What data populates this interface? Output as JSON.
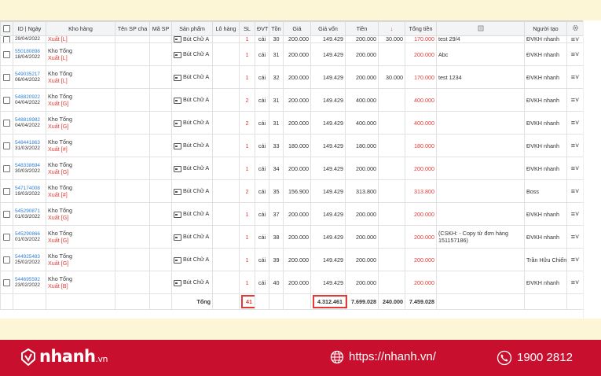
{
  "columns": [
    "",
    "ID | Ngày",
    "Kho hàng",
    "Tên SP cha",
    "Mã SP",
    "Sản phẩm",
    "Lô hàng",
    "SL",
    "ĐVT",
    "Tồn",
    "Giá",
    "Giá vốn",
    "Tiền",
    "↓",
    "Tổng tiền",
    "",
    "Người tạo",
    ""
  ],
  "partial_row": {
    "date": "29/04/2022",
    "warehouse_type": "Xuất [L]",
    "product": "Bút Chữ A",
    "qty": "1",
    "unit": "cái",
    "stock": "30",
    "price": "200.000",
    "cost": "149.429",
    "amount": "200.000",
    "discount": "30.000",
    "total": "170.000",
    "note": "test 29/4",
    "creator": "ĐVKH nhanh"
  },
  "rows": [
    {
      "id": "550180898",
      "date": "18/04/2022",
      "warehouse": "Kho Tổng",
      "warehouse_type": "Xuất [L]",
      "product": "Bút Chữ A",
      "qty": "1",
      "unit": "cái",
      "stock": "31",
      "price": "200.000",
      "cost": "149.429",
      "amount": "200.000",
      "discount": "",
      "total": "200.000",
      "note": "Abc",
      "creator": "ĐVKH nhanh"
    },
    {
      "id": "549035217",
      "date": "06/04/2022",
      "warehouse": "Kho Tổng",
      "warehouse_type": "Xuất [L]",
      "product": "Bút Chữ A",
      "qty": "1",
      "unit": "cái",
      "stock": "32",
      "price": "200.000",
      "cost": "149.429",
      "amount": "200.000",
      "discount": "30.000",
      "total": "170.000",
      "note": "test 1234",
      "creator": "ĐVKH nhanh"
    },
    {
      "id": "548820922",
      "date": "04/04/2022",
      "warehouse": "Kho Tổng",
      "warehouse_type": "Xuất [G]",
      "product": "Bút Chữ A",
      "qty": "2",
      "unit": "cái",
      "stock": "31",
      "price": "200.000",
      "cost": "149.429",
      "amount": "400.000",
      "discount": "",
      "total": "400.000",
      "note": "",
      "creator": "ĐVKH nhanh"
    },
    {
      "id": "548819982",
      "date": "04/04/2022",
      "warehouse": "Kho Tổng",
      "warehouse_type": "Xuất [G]",
      "product": "Bút Chữ A",
      "qty": "2",
      "unit": "cái",
      "stock": "31",
      "price": "200.000",
      "cost": "149.429",
      "amount": "400.000",
      "discount": "",
      "total": "400.000",
      "note": "",
      "creator": "ĐVKH nhanh"
    },
    {
      "id": "548441863",
      "date": "31/03/2022",
      "warehouse": "Kho Tổng",
      "warehouse_type": "Xuất [#]",
      "product": "Bút Chữ A",
      "qty": "1",
      "unit": "cái",
      "stock": "33",
      "price": "180.000",
      "cost": "149.429",
      "amount": "180.000",
      "discount": "",
      "total": "180.000",
      "note": "",
      "creator": "ĐVKH nhanh"
    },
    {
      "id": "548338694",
      "date": "30/03/2022",
      "warehouse": "Kho Tổng",
      "warehouse_type": "Xuất [G]",
      "product": "Bút Chữ A",
      "qty": "1",
      "unit": "cái",
      "stock": "34",
      "price": "200.000",
      "cost": "149.429",
      "amount": "200.000",
      "discount": "",
      "total": "200.000",
      "note": "",
      "creator": "ĐVKH nhanh"
    },
    {
      "id": "547174008",
      "date": "19/03/2022",
      "warehouse": "Kho Tổng",
      "warehouse_type": "Xuất [#]",
      "product": "Bút Chữ A",
      "qty": "2",
      "unit": "cái",
      "stock": "35",
      "price": "156.900",
      "cost": "149.429",
      "amount": "313.800",
      "discount": "",
      "total": "313.800",
      "note": "",
      "creator": "Boss"
    },
    {
      "id": "545290871",
      "date": "01/03/2022",
      "warehouse": "Kho Tổng",
      "warehouse_type": "Xuất [G]",
      "product": "Bút Chữ A",
      "qty": "1",
      "unit": "cái",
      "stock": "37",
      "price": "200.000",
      "cost": "149.429",
      "amount": "200.000",
      "discount": "",
      "total": "200.000",
      "note": "",
      "creator": "ĐVKH nhanh"
    },
    {
      "id": "545290866",
      "date": "01/03/2022",
      "warehouse": "Kho Tổng",
      "warehouse_type": "Xuất [G]",
      "product": "Bút Chữ A",
      "qty": "1",
      "unit": "cái",
      "stock": "38",
      "price": "200.000",
      "cost": "149.429",
      "amount": "200.000",
      "discount": "",
      "total": "200.000",
      "note": "(CSKH: - Copy từ đơn hàng 151157186)",
      "creator": "ĐVKH nhanh"
    },
    {
      "id": "544925483",
      "date": "25/02/2022",
      "warehouse": "Kho Tổng",
      "warehouse_type": "Xuất [G]",
      "product": "Bút Chữ A",
      "qty": "1",
      "unit": "cái",
      "stock": "39",
      "price": "200.000",
      "cost": "149.429",
      "amount": "200.000",
      "discount": "",
      "total": "200.000",
      "note": "",
      "creator": "Trần Hữu Chiến"
    },
    {
      "id": "544695592",
      "date": "23/02/2022",
      "warehouse": "Kho Tổng",
      "warehouse_type": "Xuất [B]",
      "product": "Bút Chữ A",
      "qty": "1",
      "unit": "cái",
      "stock": "40",
      "price": "200.000",
      "cost": "149.429",
      "amount": "200.000",
      "discount": "",
      "total": "200.000",
      "note": "",
      "creator": "ĐVKH nhanh"
    }
  ],
  "totals": {
    "label": "Tổng",
    "qty": "41",
    "cost": "4.312.461",
    "amount": "7.699.028",
    "discount": "240.000",
    "total": "7.459.028"
  },
  "footer": {
    "brand": "nhanh",
    "brand_suffix": ".vn",
    "url": "https://nhanh.vn/",
    "phone": "1900 2812"
  },
  "colors": {
    "accent": "#c8102e",
    "link": "#2f7fd6",
    "highlight": "#e53935"
  }
}
